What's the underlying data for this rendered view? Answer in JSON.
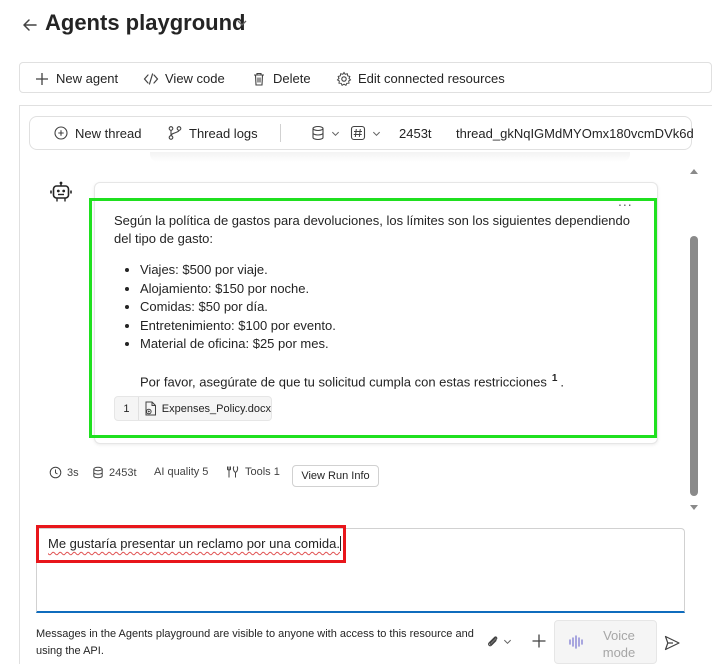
{
  "header": {
    "title": "Agents playground"
  },
  "toolbar": {
    "new_agent": "New agent",
    "view_code": "View code",
    "delete": "Delete",
    "edit_resources": "Edit connected resources"
  },
  "threadbar": {
    "new_thread": "New thread",
    "thread_logs": "Thread logs",
    "tokens": "2453t",
    "thread_id": "thread_gkNqIGMdMYOmx180vcmDVk6d"
  },
  "message": {
    "intro": "Según la política de gastos para devoluciones, los límites son los siguientes dependiendo del tipo de gasto:",
    "items": [
      "Viajes: $500 por viaje.",
      "Alojamiento: $150 por noche.",
      "Comidas: $50 por día.",
      "Entretenimiento: $100 por evento.",
      "Material de oficina: $25 por mes."
    ],
    "footer": "Por favor, asegúrate de que tu solicitud cumpla con estas restricciones",
    "citation_marker": "1",
    "trailing": ".",
    "more": "...",
    "citation": {
      "number": "1",
      "file": "Expenses_Policy.docx"
    }
  },
  "meta": {
    "time": "3s",
    "tokens": "2453t",
    "quality": "AI quality 5",
    "tools": "Tools 1",
    "run_info": "View Run Info"
  },
  "input": {
    "value": "Me gustaría presentar un reclamo por una comida."
  },
  "footer": {
    "disclaimer": "Messages in the Agents playground are visible to anyone with access to this resource and using the API.",
    "voice_mode": "Voice mode"
  },
  "colors": {
    "highlight_green": "#1fe01f",
    "highlight_red": "#e8161b",
    "accent": "#0f6cbd"
  }
}
